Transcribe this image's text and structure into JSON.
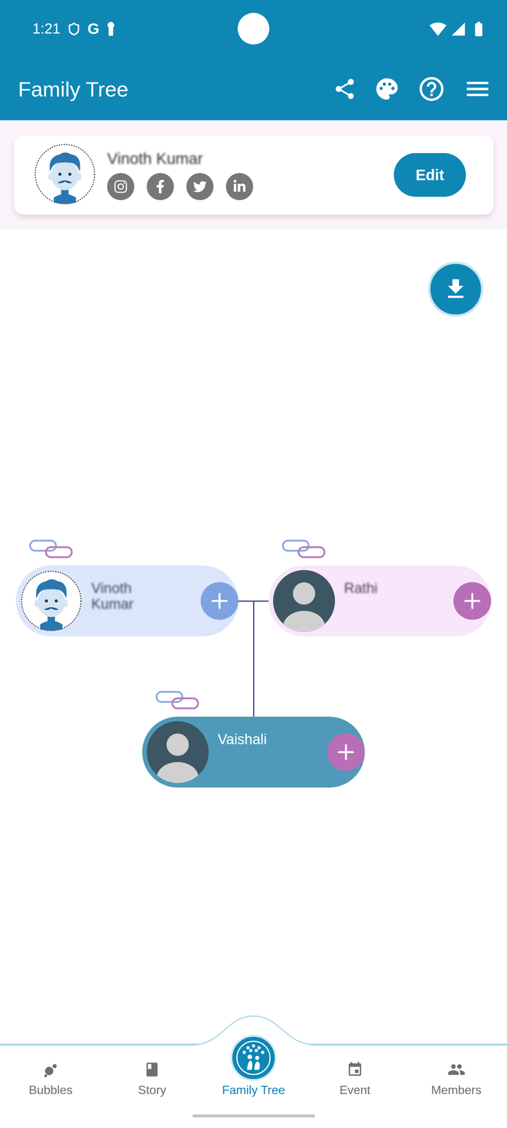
{
  "status_bar": {
    "time": "1:21",
    "app_letter": "G"
  },
  "app_bar": {
    "title": "Family Tree"
  },
  "profile": {
    "name": "Vinoth Kumar",
    "name_blurred": true,
    "avatar": "illustrated",
    "edit_button": "Edit"
  },
  "tree": {
    "parents": [
      {
        "name": "Vinoth Kumar",
        "kind": "male",
        "avatar": "illustrated",
        "name_blurred": true
      },
      {
        "name": "Rathi",
        "kind": "female",
        "avatar": "placeholder",
        "name_blurred": true
      }
    ],
    "children": [
      {
        "name": "Vaishali",
        "kind": "child",
        "avatar": "placeholder",
        "name_blurred": false
      }
    ]
  },
  "nav": [
    {
      "label": "Bubbles",
      "selected": false
    },
    {
      "label": "Story",
      "selected": false
    },
    {
      "label": "Family Tree",
      "selected": true
    },
    {
      "label": "Event",
      "selected": false
    },
    {
      "label": "Members",
      "selected": false
    }
  ]
}
